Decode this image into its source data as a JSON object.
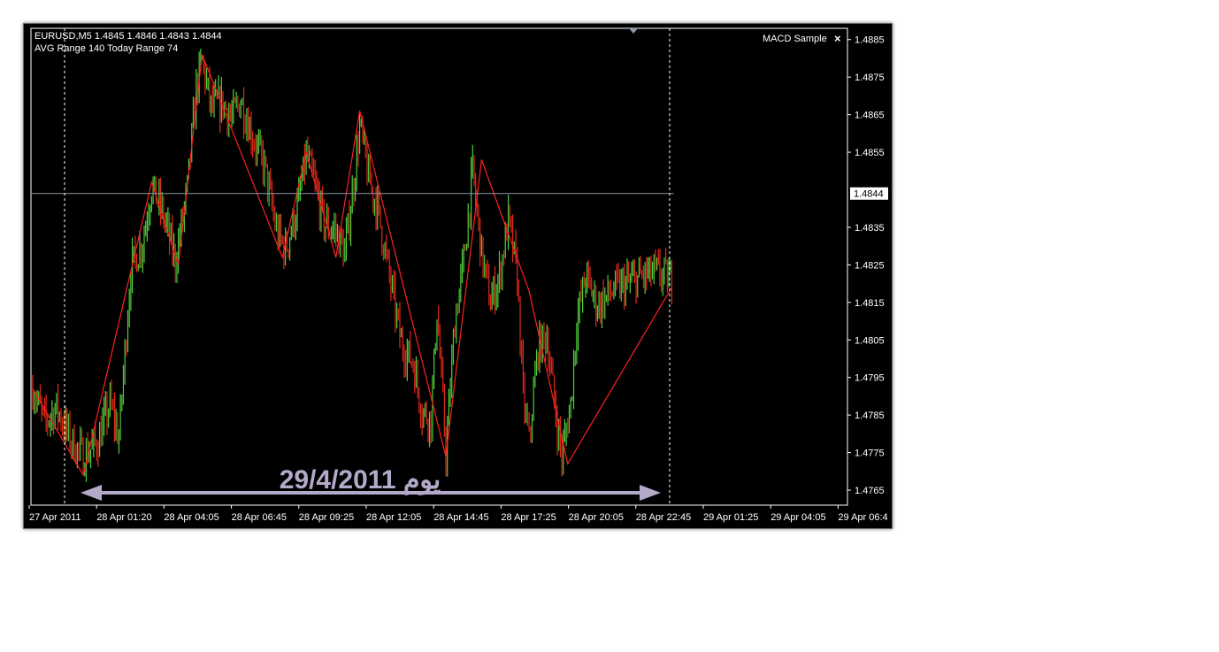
{
  "window": {
    "symbol_line": "EURUSD,M5  1.4845 1.4846 1.4843 1.4844",
    "range_line": "AVG Range 140    Today Range 74",
    "expert_label": "MACD Sample",
    "close_glyph": "×"
  },
  "annotation": {
    "text": "29/4/2011 يوم",
    "color": "#b3a9c9"
  },
  "colors": {
    "background": "#000000",
    "bull": "#4fcf3a",
    "bear": "#e02a1a",
    "zigzag": "#ff2020",
    "price_line": "#8c99a6",
    "axis_text": "#ffffff"
  },
  "chart_data": {
    "type": "line",
    "title": "EURUSD,M5",
    "x_tick_labels": [
      "27 Apr 2011",
      "28 Apr 01:20",
      "28 Apr 04:05",
      "28 Apr 06:45",
      "28 Apr 09:25",
      "28 Apr 12:05",
      "28 Apr 14:45",
      "28 Apr 17:25",
      "28 Apr 20:05",
      "28 Apr 22:45",
      "29 Apr 01:25",
      "29 Apr 04:05",
      "29 Apr 06:4"
    ],
    "y_ticks": [
      1.4885,
      1.4875,
      1.4865,
      1.4855,
      1.4835,
      1.4825,
      1.4815,
      1.4805,
      1.4795,
      1.4785,
      1.4775,
      1.4765
    ],
    "ylim": [
      1.4761,
      1.4888
    ],
    "current_price": 1.4844,
    "current_price_label": "1.4844",
    "price_path": [
      {
        "x": 0,
        "y": 1.4792
      },
      {
        "x": 8,
        "y": 1.4783
      },
      {
        "x": 16,
        "y": 1.4787
      },
      {
        "x": 26,
        "y": 1.4778
      },
      {
        "x": 34,
        "y": 1.4774
      },
      {
        "x": 44,
        "y": 1.4778
      },
      {
        "x": 52,
        "y": 1.4788
      },
      {
        "x": 58,
        "y": 1.4779
      },
      {
        "x": 66,
        "y": 1.4824
      },
      {
        "x": 74,
        "y": 1.4831
      },
      {
        "x": 80,
        "y": 1.4846
      },
      {
        "x": 88,
        "y": 1.4838
      },
      {
        "x": 96,
        "y": 1.4826
      },
      {
        "x": 104,
        "y": 1.4845
      },
      {
        "x": 110,
        "y": 1.4872
      },
      {
        "x": 114,
        "y": 1.4879
      },
      {
        "x": 120,
        "y": 1.4867
      },
      {
        "x": 128,
        "y": 1.4868
      },
      {
        "x": 134,
        "y": 1.4864
      },
      {
        "x": 140,
        "y": 1.4869
      },
      {
        "x": 148,
        "y": 1.4859
      },
      {
        "x": 156,
        "y": 1.4851
      },
      {
        "x": 164,
        "y": 1.4834
      },
      {
        "x": 170,
        "y": 1.4829
      },
      {
        "x": 178,
        "y": 1.484
      },
      {
        "x": 184,
        "y": 1.4854
      },
      {
        "x": 190,
        "y": 1.4846
      },
      {
        "x": 196,
        "y": 1.4836
      },
      {
        "x": 204,
        "y": 1.4834
      },
      {
        "x": 210,
        "y": 1.4828
      },
      {
        "x": 216,
        "y": 1.4847
      },
      {
        "x": 220,
        "y": 1.4862
      },
      {
        "x": 226,
        "y": 1.4848
      },
      {
        "x": 232,
        "y": 1.484
      },
      {
        "x": 240,
        "y": 1.4822
      },
      {
        "x": 248,
        "y": 1.4804
      },
      {
        "x": 256,
        "y": 1.4799
      },
      {
        "x": 262,
        "y": 1.4786
      },
      {
        "x": 268,
        "y": 1.4784
      },
      {
        "x": 272,
        "y": 1.4813
      },
      {
        "x": 278,
        "y": 1.4775
      },
      {
        "x": 284,
        "y": 1.481
      },
      {
        "x": 290,
        "y": 1.4826
      },
      {
        "x": 296,
        "y": 1.485
      },
      {
        "x": 302,
        "y": 1.4828
      },
      {
        "x": 308,
        "y": 1.4815
      },
      {
        "x": 314,
        "y": 1.4822
      },
      {
        "x": 320,
        "y": 1.4837
      },
      {
        "x": 326,
        "y": 1.4822
      },
      {
        "x": 330,
        "y": 1.479
      },
      {
        "x": 334,
        "y": 1.4778
      },
      {
        "x": 340,
        "y": 1.4803
      },
      {
        "x": 346,
        "y": 1.4806
      },
      {
        "x": 352,
        "y": 1.4785
      },
      {
        "x": 356,
        "y": 1.4774
      },
      {
        "x": 362,
        "y": 1.4788
      },
      {
        "x": 366,
        "y": 1.481
      },
      {
        "x": 372,
        "y": 1.4822
      },
      {
        "x": 380,
        "y": 1.4814
      },
      {
        "x": 390,
        "y": 1.4818
      },
      {
        "x": 400,
        "y": 1.482
      },
      {
        "x": 410,
        "y": 1.4822
      },
      {
        "x": 420,
        "y": 1.4823
      },
      {
        "x": 430,
        "y": 1.4821
      }
    ],
    "zigzag": [
      {
        "x": 0,
        "y": 1.4792
      },
      {
        "x": 34,
        "y": 1.4769
      },
      {
        "x": 80,
        "y": 1.4847
      },
      {
        "x": 98,
        "y": 1.4825
      },
      {
        "x": 114,
        "y": 1.4881
      },
      {
        "x": 168,
        "y": 1.4827
      },
      {
        "x": 184,
        "y": 1.4855
      },
      {
        "x": 204,
        "y": 1.4827
      },
      {
        "x": 220,
        "y": 1.4866
      },
      {
        "x": 278,
        "y": 1.4774
      },
      {
        "x": 302,
        "y": 1.4853
      },
      {
        "x": 334,
        "y": 1.4818
      },
      {
        "x": 360,
        "y": 1.4772
      },
      {
        "x": 430,
        "y": 1.4819
      }
    ]
  }
}
